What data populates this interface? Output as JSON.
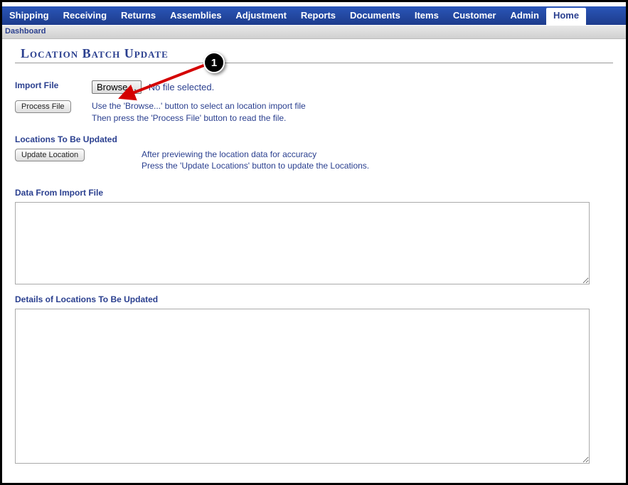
{
  "nav": {
    "items": [
      "Shipping",
      "Receiving",
      "Returns",
      "Assemblies",
      "Adjustment",
      "Reports",
      "Documents",
      "Items",
      "Customer",
      "Admin",
      "Home"
    ],
    "active_index": 10
  },
  "subnav": {
    "label": "Dashboard"
  },
  "page": {
    "title": "Location Batch Update"
  },
  "import": {
    "label": "Import File",
    "browse_label": "Browse…",
    "nofile_text": "No file selected.",
    "process_label": "Process File",
    "help_line1": "Use the 'Browse...' button to select an location import file",
    "help_line2": "Then press the 'Process File' button to read the file."
  },
  "update": {
    "section_label": "Locations To Be Updated",
    "button_label": "Update Location",
    "help_line1": "After previewing the location data for accuracy",
    "help_line2": "Press the 'Update Locations' button to update the Locations."
  },
  "data_box1": {
    "label": "Data From Import File",
    "value": ""
  },
  "data_box2": {
    "label": "Details of Locations To Be Updated",
    "value": ""
  },
  "annotation": {
    "marker": "1"
  }
}
